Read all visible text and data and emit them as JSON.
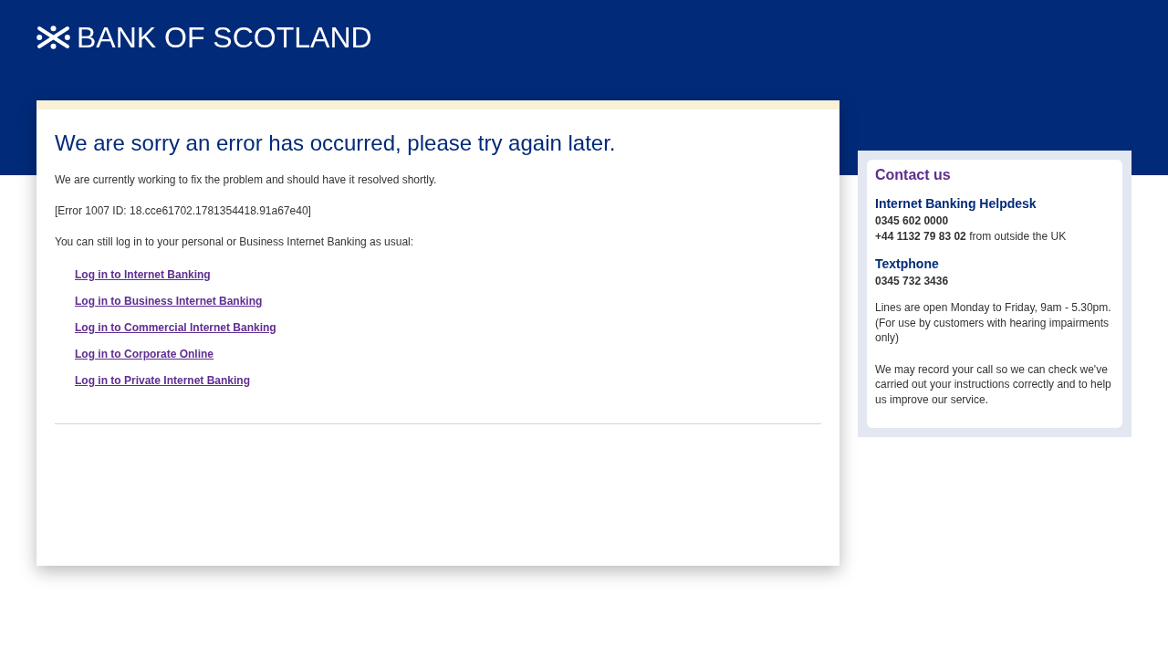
{
  "header": {
    "brand_name": "BANK OF SCOTLAND"
  },
  "error_panel": {
    "title": "We are sorry an error has occurred, please try again later.",
    "paragraphs": [
      "We are currently working to fix the problem and should have it resolved shortly.",
      "[Error 1007 ID: 18.cce61702.1781354418.91a67e40]",
      "You can still log in to your personal or Business Internet Banking as usual:"
    ],
    "links": [
      "Log in to Internet Banking",
      "Log in to Business Internet Banking",
      "Log in to Commercial Internet Banking",
      "Log in to Corporate Online",
      "Log in to Private Internet Banking"
    ]
  },
  "contact_panel": {
    "title": "Contact us",
    "sections": [
      {
        "heading": "Internet Banking Helpdesk",
        "lines": [
          {
            "number": "0345 602 0000"
          },
          {
            "number": "+44 1132 79 83 02",
            "note": "from outside the UK"
          }
        ]
      },
      {
        "heading": "Textphone",
        "lines": [
          {
            "number": "0345 732 3436"
          }
        ]
      }
    ],
    "notes": [
      "Lines are open Monday to Friday, 9am - 5.30pm. (For use by customers with hearing impairments only)",
      "We may record your call so we can check we've carried out your instructions correctly and to help us improve our service."
    ]
  }
}
